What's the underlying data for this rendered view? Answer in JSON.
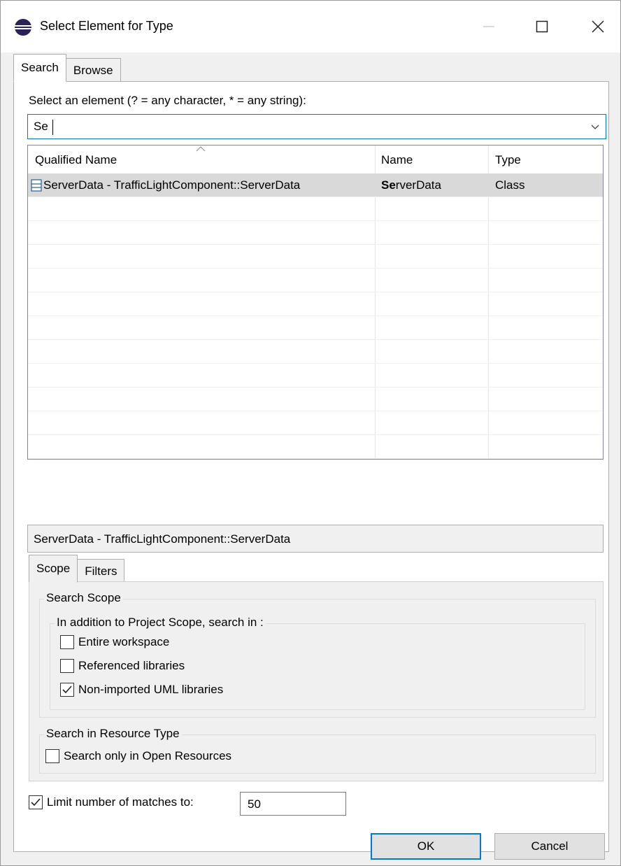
{
  "window": {
    "title": "Select Element for Type",
    "minimize_glyph": "—",
    "maximize_icon": "maximize-icon",
    "close_icon": "close-icon"
  },
  "tabs": [
    {
      "label": "Search",
      "active": true
    },
    {
      "label": "Browse",
      "active": false
    }
  ],
  "search": {
    "label": "Select an element (? = any character, * = any string):",
    "value": "Se"
  },
  "table": {
    "columns": [
      "Qualified Name",
      "Name",
      "Type"
    ],
    "rows": [
      {
        "qualified_name": "ServerData - TrafficLightComponent::ServerData",
        "name_match": "Se",
        "name_rest": "rverData",
        "type": "Class",
        "icon": "class-icon"
      }
    ]
  },
  "detail": {
    "text": "ServerData - TrafficLightComponent::ServerData"
  },
  "inner_tabs": [
    {
      "label": "Scope",
      "active": true
    },
    {
      "label": "Filters",
      "active": false
    }
  ],
  "scope": {
    "group_title": "Search Scope",
    "subgroup_title": "In addition to Project Scope, search in :",
    "options": [
      {
        "label": "Entire workspace",
        "checked": false
      },
      {
        "label": "Referenced libraries",
        "checked": false
      },
      {
        "label": "Non-imported UML libraries",
        "checked": true
      }
    ],
    "resource_group_title": "Search in Resource Type",
    "resource_option": {
      "label": "Search only in Open Resources",
      "checked": false
    }
  },
  "limit": {
    "label": "Limit number of matches to:",
    "checked": true,
    "value": "50"
  },
  "buttons": {
    "ok": "OK",
    "cancel": "Cancel"
  },
  "colors": {
    "accent": "#0078d7",
    "selection": "#d9d9d9",
    "dialog_bg": "#f0f0f0"
  }
}
